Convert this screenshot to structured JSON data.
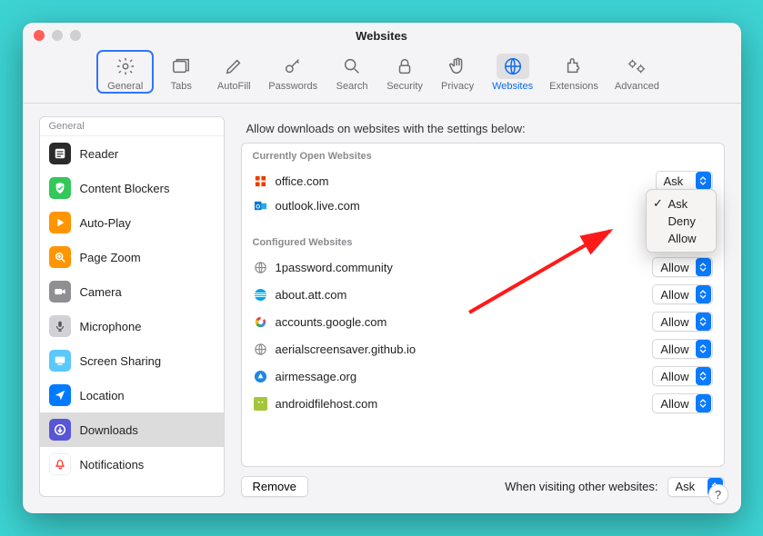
{
  "window": {
    "title": "Websites"
  },
  "toolbar": {
    "items": [
      {
        "label": "General"
      },
      {
        "label": "Tabs"
      },
      {
        "label": "AutoFill"
      },
      {
        "label": "Passwords"
      },
      {
        "label": "Search"
      },
      {
        "label": "Security"
      },
      {
        "label": "Privacy"
      },
      {
        "label": "Websites"
      },
      {
        "label": "Extensions"
      },
      {
        "label": "Advanced"
      }
    ]
  },
  "sidebar": {
    "header": "General",
    "items": [
      {
        "label": "Reader",
        "icon": "reader-icon",
        "bg": "#2b2b2b"
      },
      {
        "label": "Content Blockers",
        "icon": "shield-icon",
        "bg": "#34c759"
      },
      {
        "label": "Auto-Play",
        "icon": "play-icon",
        "bg": "#ff9500"
      },
      {
        "label": "Page Zoom",
        "icon": "zoom-icon",
        "bg": "#ff9500"
      },
      {
        "label": "Camera",
        "icon": "camera-icon",
        "bg": "#8e8e93"
      },
      {
        "label": "Microphone",
        "icon": "mic-icon",
        "bg": "#d1d1d6"
      },
      {
        "label": "Screen Sharing",
        "icon": "screen-icon",
        "bg": "#5ac8fa"
      },
      {
        "label": "Location",
        "icon": "location-icon",
        "bg": "#007aff"
      },
      {
        "label": "Downloads",
        "icon": "download-icon",
        "bg": "#5856d6"
      },
      {
        "label": "Notifications",
        "icon": "bell-icon",
        "bg": "#ffffff"
      }
    ],
    "active_index": 8
  },
  "content": {
    "heading": "Allow downloads on websites with the settings below:",
    "open_header": "Currently Open Websites",
    "configured_header": "Configured Websites",
    "open_sites": [
      {
        "name": "office.com",
        "value": "Ask",
        "favicon": "office-icon"
      },
      {
        "name": "outlook.live.com",
        "value": "Ask",
        "favicon": "outlook-icon"
      }
    ],
    "configured_sites": [
      {
        "name": "1password.community",
        "value": "Allow",
        "favicon": "globe-icon"
      },
      {
        "name": "about.att.com",
        "value": "Allow",
        "favicon": "att-icon"
      },
      {
        "name": "accounts.google.com",
        "value": "Allow",
        "favicon": "google-icon"
      },
      {
        "name": "aerialscreensaver.github.io",
        "value": "Allow",
        "favicon": "globe-icon"
      },
      {
        "name": "airmessage.org",
        "value": "Allow",
        "favicon": "airmessage-icon"
      },
      {
        "name": "androidfilehost.com",
        "value": "Allow",
        "favicon": "android-icon"
      }
    ],
    "popup": {
      "options": [
        "Ask",
        "Deny",
        "Allow"
      ],
      "selected": "Ask"
    },
    "remove_label": "Remove",
    "footer_label": "When visiting other websites:",
    "footer_value": "Ask"
  },
  "help_label": "?"
}
